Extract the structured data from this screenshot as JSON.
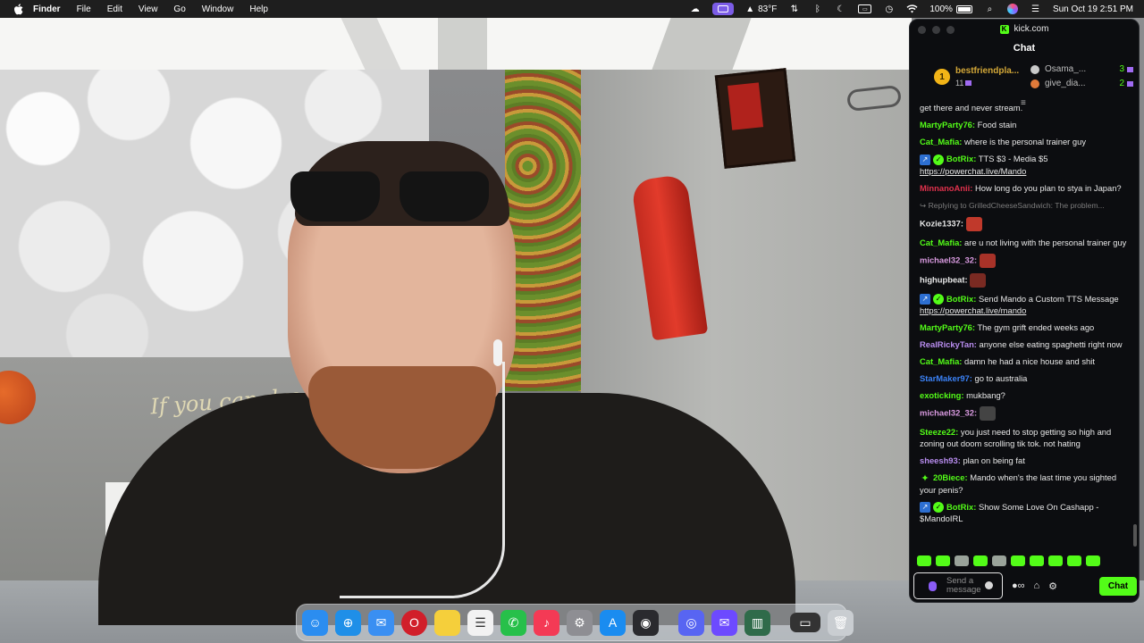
{
  "menubar": {
    "app_name": "Finder",
    "menus": [
      "File",
      "Edit",
      "View",
      "Go",
      "Window",
      "Help"
    ],
    "temperature": "83°F",
    "battery_percent": "100%",
    "datetime": "Sun Oct 19  2:51 PM"
  },
  "video": {
    "neon_sign_text": "If you can dream it, yo"
  },
  "chat_window": {
    "site": "kick.com",
    "title": "Chat",
    "leaderboard": {
      "top": {
        "rank": "1",
        "name": "bestfriendpla...",
        "count": "11"
      },
      "others": [
        {
          "name": "Osama_...",
          "count": "3"
        },
        {
          "name": "give_dia...",
          "count": "2"
        }
      ]
    },
    "messages": [
      {
        "user": "",
        "text": "get there and never stream.",
        "color": "#e8e8e8"
      },
      {
        "user": "MartyParty76:",
        "text": "Food stain",
        "color": "#53fc18"
      },
      {
        "user": "Cat_Mafia:",
        "text": "where is the personal trainer guy",
        "color": "#53fc18"
      },
      {
        "user": "BotRix:",
        "text": "TTS $3 - Media $5",
        "link": "https://powerchat.live/Mando",
        "color": "#53fc18",
        "badges": [
          "bot",
          "verified"
        ]
      },
      {
        "user": "MinnanoAnii:",
        "text": "How long do you plan to stya in Japan?",
        "color": "#e0314c"
      },
      {
        "reply": "Replying to GrilledCheeseSandwich: The problem..."
      },
      {
        "user": "Kozie1337:",
        "text": "",
        "color": "#e8e8e8",
        "emote": "#c0392b"
      },
      {
        "user": "Cat_Mafia:",
        "text": "are u not living with the personal trainer guy",
        "color": "#53fc18"
      },
      {
        "user": "michael32_32:",
        "text": "",
        "color": "#d99ae0",
        "emote": "#a83228"
      },
      {
        "user": "highupbeat:",
        "text": "",
        "color": "#e8e8e8",
        "emote": "#7a2a22"
      },
      {
        "user": "BotRix:",
        "text": "Send Mando a Custom TTS Message",
        "link": "https://powerchat.live/mando",
        "color": "#53fc18",
        "badges": [
          "bot",
          "verified"
        ]
      },
      {
        "user": "MartyParty76:",
        "text": "The gym grift ended weeks ago",
        "color": "#53fc18"
      },
      {
        "user": "RealRickyTan:",
        "text": "anyone else eating spaghetti right now",
        "color": "#b98df0"
      },
      {
        "user": "Cat_Mafia:",
        "text": "damn he had a nice house and shit",
        "color": "#53fc18"
      },
      {
        "user": "StarMaker97:",
        "text": "go to australia",
        "color": "#3b82f6"
      },
      {
        "user": "exoticking:",
        "text": "mukbang?",
        "color": "#53fc18"
      },
      {
        "user": "michael32_32:",
        "text": "",
        "color": "#d99ae0",
        "emote": "#444444"
      },
      {
        "user": "Steeze22:",
        "text": "you just need to stop getting so high and zoning out doom scrolling tik tok. not hating",
        "color": "#53fc18"
      },
      {
        "user": "sheesh93:",
        "text": "plan on being fat",
        "color": "#b98df0"
      },
      {
        "user": "20Biece:",
        "text": "Mando when's the last time you sighted your penis?",
        "color": "#53fc18",
        "badges": [
          "star"
        ]
      },
      {
        "user": "BotRix:",
        "text": "Show Some Love On Cashapp - $MandoIRL",
        "color": "#53fc18",
        "badges": [
          "bot",
          "verified"
        ]
      }
    ],
    "input_placeholder": "Send a message",
    "send_button": "Chat"
  },
  "dock": {
    "apps": [
      {
        "name": "finder",
        "color": "#2b8df0"
      },
      {
        "name": "safari",
        "color": "#1f8fe8"
      },
      {
        "name": "mail",
        "color": "#3a8ff2"
      },
      {
        "name": "opera",
        "color": "#d11f2a"
      },
      {
        "name": "notes",
        "color": "#f5cf3b"
      },
      {
        "name": "reminders",
        "color": "#f2f2f2"
      },
      {
        "name": "whatsapp",
        "color": "#27c04a"
      },
      {
        "name": "music",
        "color": "#f43a55"
      },
      {
        "name": "system-settings",
        "color": "#8e8e93"
      },
      {
        "name": "app-store",
        "color": "#1a8cf0"
      },
      {
        "name": "obs",
        "color": "#2a2a2e"
      },
      {
        "name": "discord",
        "color": "#5865f2"
      },
      {
        "name": "proton-mail",
        "color": "#6d4aff"
      },
      {
        "name": "chatgpt-atlas",
        "color": "#2f6b4a"
      },
      {
        "name": "window-thumbnail",
        "color": "#333333"
      },
      {
        "name": "trash",
        "color": "#c9cdd1"
      }
    ]
  }
}
